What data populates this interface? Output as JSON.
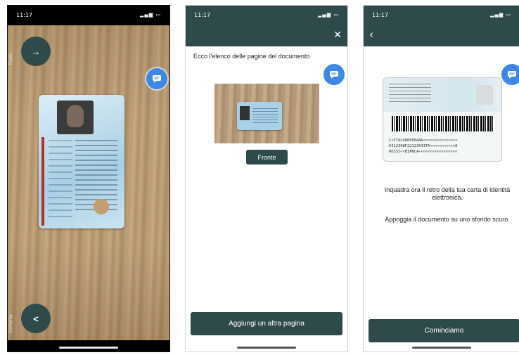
{
  "colors": {
    "primary_dark": "#2f4a4b",
    "chat_blue": "#3c88e6"
  },
  "screens": [
    {
      "status_time": "11:17",
      "top_button_label": "→",
      "side_label_top": "Ruota",
      "side_label_bottom": "Conferma",
      "chat_icon": "chat-bubble-icon"
    },
    {
      "status_time": "11:17",
      "close_icon": "close-icon",
      "title": "Ecco l'elenco delle pagine del documento",
      "page_tag": "Fronte",
      "add_page_button": "Aggiungi un altra pagina",
      "chat_icon": "chat-bubble-icon"
    },
    {
      "status_time": "11:17",
      "back_icon": "back-arrow-icon",
      "mrz_lines": [
        "C<ITACA00000AAA<<<<<<<<<<<<<<<",
        "6412308F2212304ITA<<<<<<<<<<<8",
        "ROSSI<<BIANCA<<<<<<<<<<<<<<<<<"
      ],
      "instruction_1": "Inquadra ora il retro  della tua carta di identità elettronica.",
      "instruction_2": "Appoggia il documento su uno sfondo scuro.",
      "start_button": "Cominciamo",
      "chat_icon": "chat-bubble-icon"
    }
  ]
}
